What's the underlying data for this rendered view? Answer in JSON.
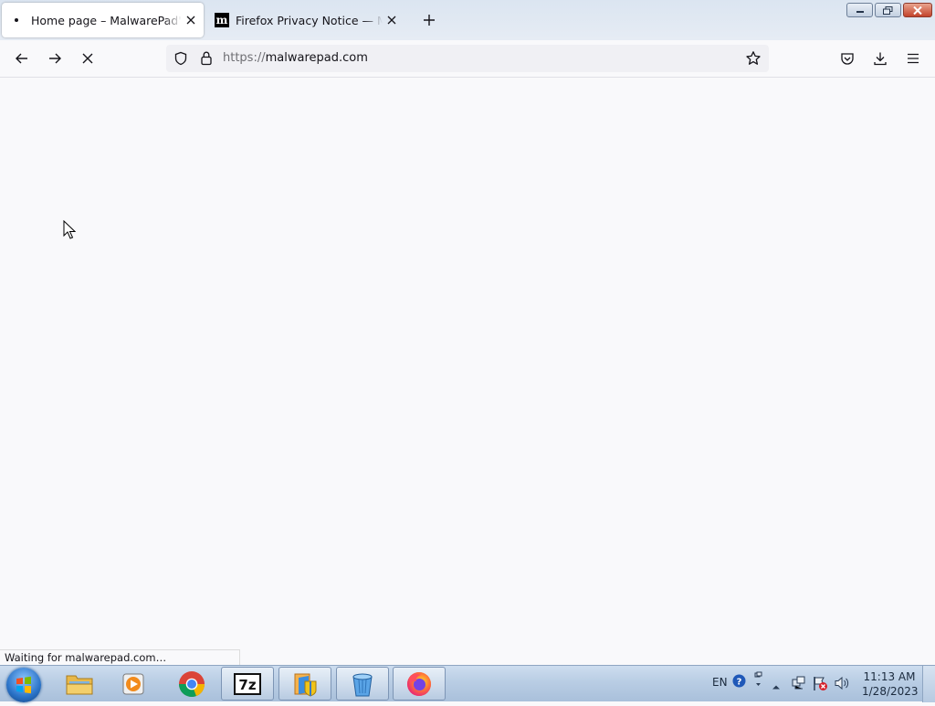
{
  "tabs": [
    {
      "title": "Home page – MalwarePad's",
      "active": true,
      "loading": true
    },
    {
      "title": "Firefox Privacy Notice — Moz",
      "active": false,
      "favicon": "m"
    }
  ],
  "url": {
    "scheme": "https://",
    "host": "malwarepad.com"
  },
  "status_text": "Waiting for malwarepad.com…",
  "taskbar": {
    "apps": [
      "windows-explorer",
      "media-player",
      "chrome",
      "7-zip",
      "installer",
      "recycle-bin",
      "firefox"
    ],
    "language": "EN",
    "time": "11:13 AM",
    "date": "1/28/2023"
  },
  "colors": {
    "accent": "#0060df",
    "taskbar": "#b9cde4",
    "content_bg": "#f9f9fb"
  }
}
